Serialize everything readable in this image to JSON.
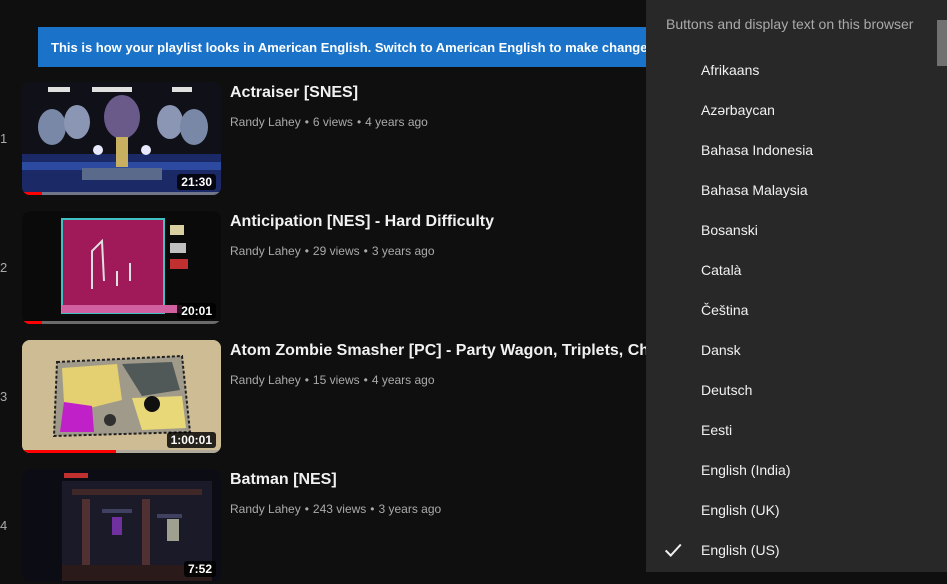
{
  "banner": {
    "text": "This is how your playlist looks in American English. Switch to American English to make changes."
  },
  "videos": [
    {
      "index": "1",
      "title": "Actraiser [SNES]",
      "channel": "Randy Lahey",
      "views": "6 views",
      "age": "4 years ago",
      "duration": "21:30",
      "progress": 0.1
    },
    {
      "index": "2",
      "title": "Anticipation [NES] - Hard Difficulty",
      "channel": "Randy Lahey",
      "views": "29 views",
      "age": "3 years ago",
      "duration": "20:01",
      "progress": 0.1
    },
    {
      "index": "3",
      "title": "Atom Zombie Smasher [PC] - Party Wagon, Triplets, Choose Your Own Adventure",
      "channel": "Randy Lahey",
      "views": "15 views",
      "age": "4 years ago",
      "duration": "1:00:01",
      "progress": 0.47
    },
    {
      "index": "4",
      "title": "Batman [NES]",
      "channel": "Randy Lahey",
      "views": "243 views",
      "age": "3 years ago",
      "duration": "7:52",
      "progress": 0
    }
  ],
  "language_menu": {
    "header": "Buttons and display text on this browser",
    "items": [
      {
        "label": "Afrikaans",
        "selected": false
      },
      {
        "label": "Azərbaycan",
        "selected": false
      },
      {
        "label": "Bahasa Indonesia",
        "selected": false
      },
      {
        "label": "Bahasa Malaysia",
        "selected": false
      },
      {
        "label": "Bosanski",
        "selected": false
      },
      {
        "label": "Català",
        "selected": false
      },
      {
        "label": "Čeština",
        "selected": false
      },
      {
        "label": "Dansk",
        "selected": false
      },
      {
        "label": "Deutsch",
        "selected": false
      },
      {
        "label": "Eesti",
        "selected": false
      },
      {
        "label": "English (India)",
        "selected": false
      },
      {
        "label": "English (UK)",
        "selected": false
      },
      {
        "label": "English (US)",
        "selected": true
      }
    ],
    "check_icon": "check-icon"
  },
  "colors": {
    "banner": "#1a73c8",
    "progress": "#ff0000",
    "menu_bg": "#282828",
    "page_bg": "#0f0f0f"
  }
}
